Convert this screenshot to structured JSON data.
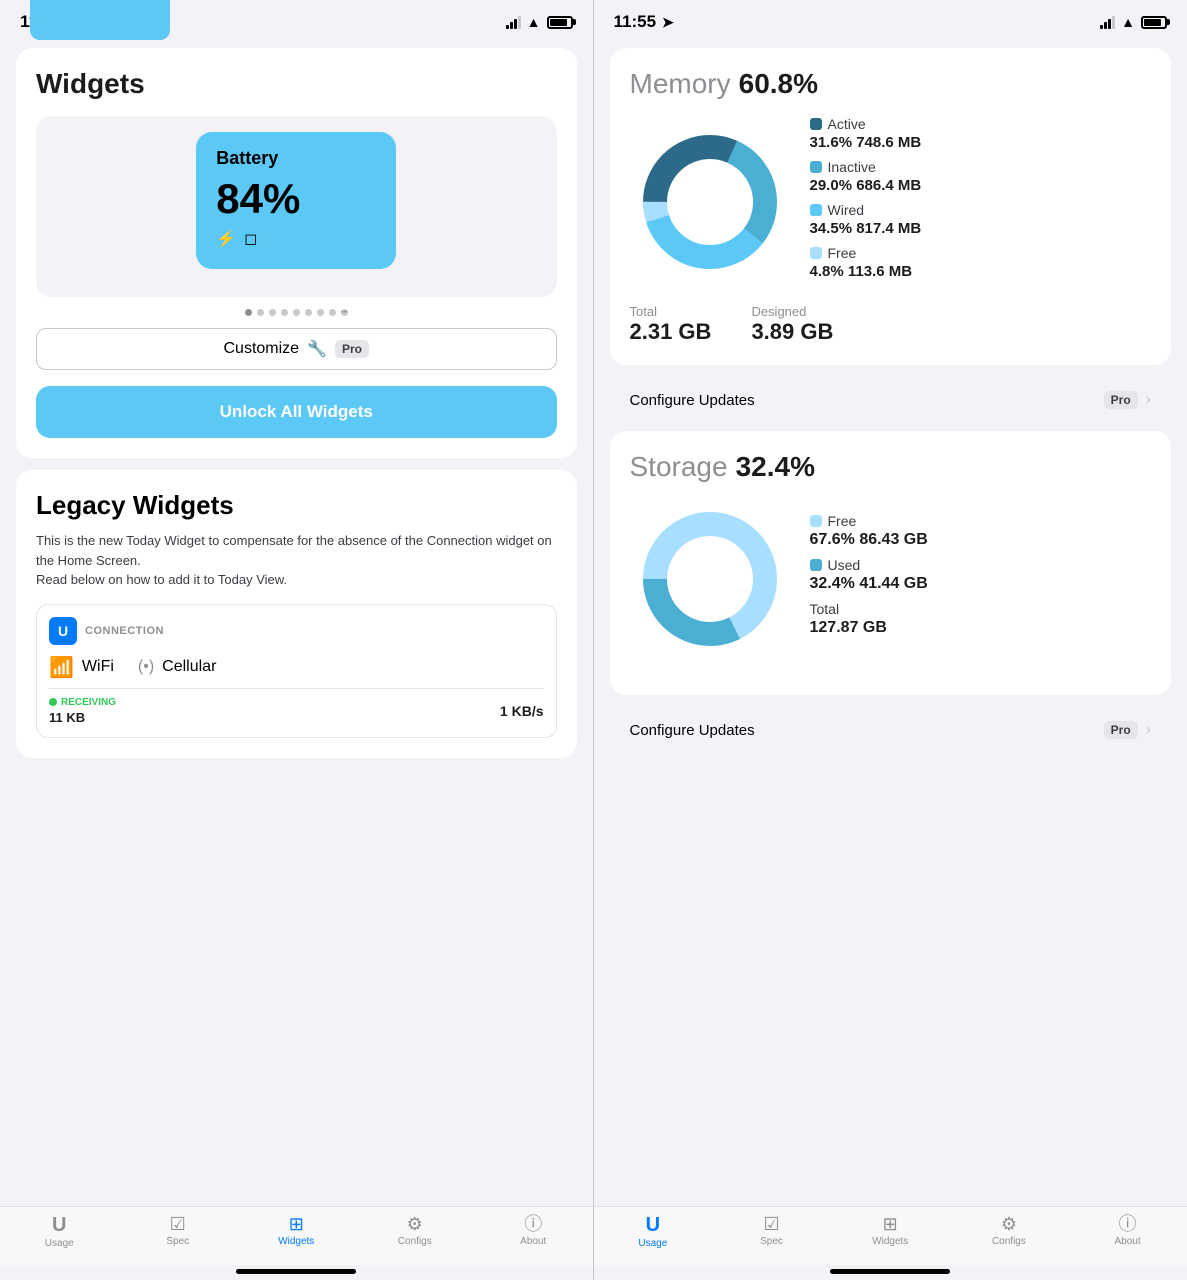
{
  "left_screen": {
    "status_time": "11:55",
    "widgets_title": "Widgets",
    "battery_widget": {
      "title": "Battery",
      "percentage": "84%",
      "icon_bolt": "⚡",
      "icon_box": "□"
    },
    "customize_label": "Customize",
    "customize_icon": "🔧",
    "pro_label": "Pro",
    "unlock_label": "Unlock All Widgets",
    "legacy_title": "Legacy Widgets",
    "legacy_desc": "This is the new Today Widget to compensate for the absence of the Connection widget on the Home Screen.\nRead below on how to add it to Today View.",
    "connection_logo": "U",
    "connection_title": "CONNECTION",
    "wifi_label": "WiFi",
    "cellular_label": "Cellular",
    "receiving_label": "RECEIVING",
    "kb_label": "11 KB",
    "speed_label": "1 KB/s",
    "tabs": [
      {
        "icon": "U",
        "label": "Usage",
        "active": false,
        "type": "u"
      },
      {
        "icon": "✓≡",
        "label": "Spec",
        "active": false,
        "type": "check"
      },
      {
        "icon": "⊞",
        "label": "Widgets",
        "active": true,
        "type": "widgets"
      },
      {
        "icon": "⚙",
        "label": "Configs",
        "active": false,
        "type": "gear"
      },
      {
        "icon": "ⓘ",
        "label": "About",
        "active": false,
        "type": "info"
      }
    ]
  },
  "right_screen": {
    "status_time": "11:55",
    "memory_label": "Memory",
    "memory_pct": "60.8%",
    "memory_legend": [
      {
        "color": "#2d6a8a",
        "label": "Active",
        "pct": "31.6%",
        "size": "748.6 MB"
      },
      {
        "color": "#4bafd4",
        "label": "Inactive",
        "pct": "29.0%",
        "size": "686.4 MB"
      },
      {
        "color": "#5bc8f5",
        "label": "Wired",
        "pct": "34.5%",
        "size": "817.4 MB"
      },
      {
        "color": "#a8dfff",
        "label": "Free",
        "pct": "4.8%",
        "size": "113.6 MB"
      }
    ],
    "memory_total_label": "Total",
    "memory_total": "2.31 GB",
    "memory_designed_label": "Designed",
    "memory_designed": "3.89 GB",
    "configure_updates": "Configure Updates",
    "pro_label": "Pro",
    "storage_label": "Storage",
    "storage_pct": "32.4%",
    "storage_legend": [
      {
        "color": "#a8dfff",
        "label": "Free",
        "pct": "67.6%",
        "size": "86.43 GB"
      },
      {
        "color": "#4bafd4",
        "label": "Used",
        "pct": "32.4%",
        "size": "41.44 GB"
      }
    ],
    "storage_total_label": "Total",
    "storage_total": "127.87 GB",
    "tabs": [
      {
        "icon": "U",
        "label": "Usage",
        "active": true,
        "type": "u"
      },
      {
        "icon": "✓≡",
        "label": "Spec",
        "active": false,
        "type": "check"
      },
      {
        "icon": "⊞",
        "label": "Widgets",
        "active": false,
        "type": "widgets"
      },
      {
        "icon": "⚙",
        "label": "Configs",
        "active": false,
        "type": "gear"
      },
      {
        "icon": "ⓘ",
        "label": "About",
        "active": false,
        "type": "info"
      }
    ]
  }
}
